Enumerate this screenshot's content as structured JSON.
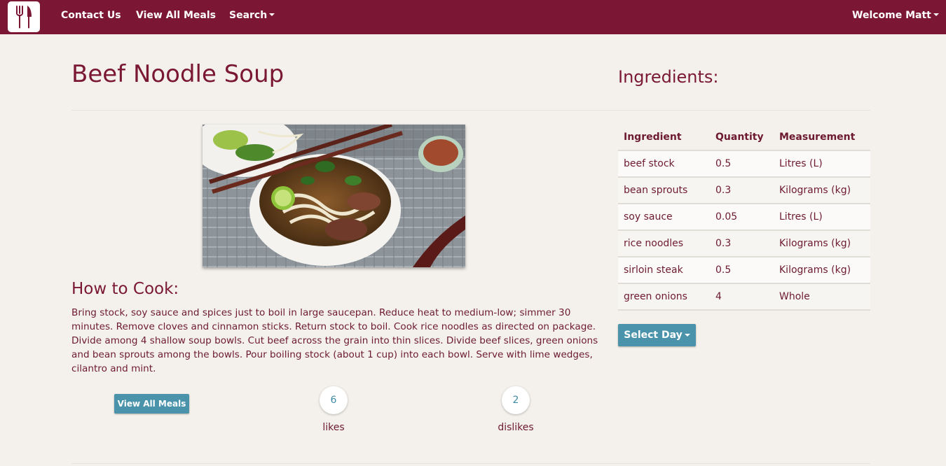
{
  "nav": {
    "logo_icon": "fork-knife-icon",
    "contact": "Contact Us",
    "view_all": "View All Meals",
    "search": "Search",
    "welcome": "Welcome Matt"
  },
  "meal": {
    "title": "Beef Noodle Soup",
    "howto_heading": "How to Cook:",
    "instructions": "Bring stock, soy sauce and spices just to boil in large saucepan. Reduce heat to medium-low; simmer 30 minutes. Remove cloves and cinnamon sticks. Return stock to boil. Cook rice noodles as directed on package. Divide among 4 shallow soup bowls. Cut beef across the grain into thin slices. Divide beef slices, green onions and bean sprouts among the bowls. Pour boiling stock (about 1 cup) into each bowl. Serve with lime wedges, cilantro and mint.",
    "view_all_button": "View All Meals",
    "likes_count": "6",
    "likes_label": "likes",
    "dislikes_count": "2",
    "dislikes_label": "dislikes"
  },
  "ingredients": {
    "heading": "Ingredients:",
    "columns": [
      "Ingredient",
      "Quantity",
      "Measurement"
    ],
    "rows": [
      [
        "beef stock",
        "0.5",
        "Litres (L)"
      ],
      [
        "bean sprouts",
        "0.3",
        "Kilograms (kg)"
      ],
      [
        "soy sauce",
        "0.05",
        "Litres (L)"
      ],
      [
        "rice noodles",
        "0.3",
        "Kilograms (kg)"
      ],
      [
        "sirloin steak",
        "0.5",
        "Kilograms (kg)"
      ],
      [
        "green onions",
        "4",
        "Whole"
      ]
    ],
    "select_day_button": "Select Day"
  },
  "colors": {
    "brand": "#7b1734",
    "accent": "#4a93ab",
    "background": "#f4f1ec"
  }
}
